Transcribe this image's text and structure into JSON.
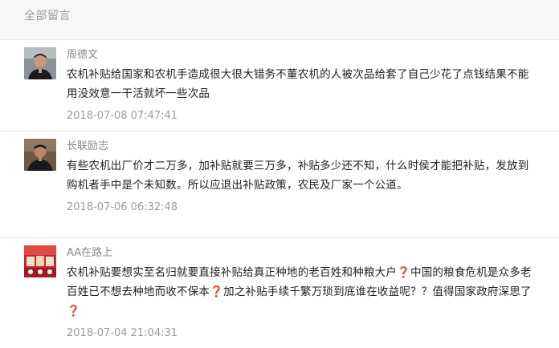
{
  "section_title": "全部留言",
  "comments": [
    {
      "name": "周德文",
      "text": "农机补贴给国家和农机手造成很大很大错务不董农机的人被次品给套了自己少花了点钱结果不能用没效意一干活就坏一些次品",
      "time": "2018-07-08 07:47:41",
      "avatar_icon": "user-photo-avatar"
    },
    {
      "name": "长联励志",
      "text": "有些农机出厂价才二万多，加补贴就要三万多，补贴多少还不知，什么时侯才能把补贴，发放到购机者手中是个未知数。所以应退出补贴政策，农民及厂家一个公道。",
      "time": "2018-07-06 06:32:48",
      "avatar_icon": "user-photo-avatar"
    },
    {
      "name": "AA在路上",
      "text_parts": [
        "农机补贴要想实至名归就要直接补贴给真正种地的老百姓和种粮大户",
        "❓",
        "中国的粮食危机是众多老百姓已不想去种地而收不保本",
        "❓",
        "加之补贴手续千繁万琐到底谁在收益呢？？值得国家政府深思了",
        "❓"
      ],
      "time": "2018-07-04 21:04:31",
      "avatar_icon": "user-photo-avatar"
    }
  ],
  "colors": {
    "header_bg": "#f7f7f7",
    "name": "#8a8a8a",
    "text": "#1e1e1e",
    "time": "#9b9b9b",
    "question_mark": "#d81e3a"
  }
}
